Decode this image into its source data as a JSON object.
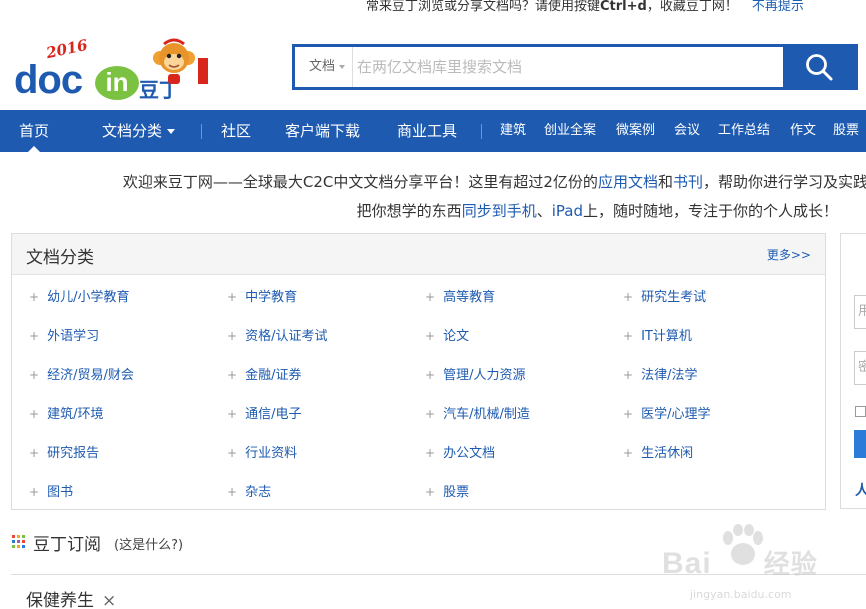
{
  "top_tip": {
    "text": "常来豆丁浏览或分享文档吗？请使用按键",
    "shortcut": "Ctrl+d",
    "text2": "，收藏豆丁网！",
    "dismiss": "不再提示"
  },
  "logo": {
    "year": "2016",
    "doc": "doc",
    "in": "in",
    "cn": "豆丁"
  },
  "search": {
    "type_label": "文档",
    "placeholder": "在两亿文档库里搜索文档"
  },
  "nav": {
    "home": "首页",
    "categories": "文档分类",
    "community": "社区",
    "download": "客户端下载",
    "business": "商业工具",
    "links": [
      "建筑",
      "创业全案",
      "微案例",
      "会议",
      "工作总结",
      "作文",
      "股票"
    ]
  },
  "welcome": {
    "line1_a": "欢迎来豆丁网——全球最大C2C中文文档分享平台！这里有超过2亿份的",
    "line1_link1": "应用文档",
    "line1_b": "和",
    "line1_link2": "书刊",
    "line1_c": "，帮助你进行学习及实践",
    "line2_a": "把你想学的东西",
    "line2_link1": "同步到手机",
    "line2_b": "、",
    "line2_link2": "iPad",
    "line2_c": "上，随时随地，专注于你的个人成长！"
  },
  "categories": {
    "title": "文档分类",
    "more": "更多>>",
    "items": [
      "幼儿/小学教育",
      "中学教育",
      "高等教育",
      "研究生考试",
      "外语学习",
      "资格/认证考试",
      "论文",
      "IT计算机",
      "经济/贸易/财会",
      "金融/证券",
      "管理/人力资源",
      "法律/法学",
      "建筑/环境",
      "通信/电子",
      "汽车/机械/制造",
      "医学/心理学",
      "研究报告",
      "行业资料",
      "办公文档",
      "生活休闲",
      "图书",
      "杂志",
      "股票"
    ]
  },
  "right_panel": {
    "field1": "用",
    "field2": "密"
  },
  "subscribe": {
    "title": "豆丁订阅",
    "hint": "(这是什么?)",
    "icon_colors": [
      "#e94b35",
      "#f5a623",
      "#7cc242",
      "#2b7bd8",
      "#9b59b6",
      "#e94b35",
      "#7cc242",
      "#f5a623",
      "#2b7bd8"
    ]
  },
  "tag": {
    "label": "保健养生",
    "close": "×"
  },
  "watermark": {
    "text": "Bai",
    "text2": "经验",
    "url": "jingyan.baidu.com"
  },
  "colors": {
    "brand": "#1e5bb0",
    "accent_green": "#7cc242"
  }
}
